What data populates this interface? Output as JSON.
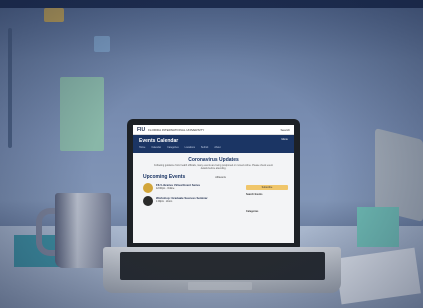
{
  "site": {
    "logo": "FIU",
    "university": "FLORIDA INTERNATIONAL UNIVERSITY",
    "top_right": "Search",
    "banner_title": "Events Calendar",
    "banner_right": "Menu",
    "nav": [
      "Home",
      "Calendar",
      "Categories",
      "Locations",
      "Submit",
      "About"
    ]
  },
  "content": {
    "update_title": "Coronavirus Updates",
    "update_body": "Following guidance from health officials, many events are being postponed or moved online. Please check event details before attending.",
    "upcoming_title": "Upcoming Events",
    "filters": "All Events",
    "events": [
      {
        "title": "FIU Libraries Virtual Event Series",
        "meta": "12:00pm · Online"
      },
      {
        "title": "Workshop: Graduate Success Seminar",
        "meta": "1:00pm · Zoom"
      }
    ],
    "side": {
      "subscribe": "Subscribe",
      "search_label": "Search Events",
      "categories_label": "Categories"
    }
  },
  "colors": {
    "brand_navy": "#1b3564",
    "gold": "#f0c66b",
    "background_tint": "#5b7096"
  }
}
